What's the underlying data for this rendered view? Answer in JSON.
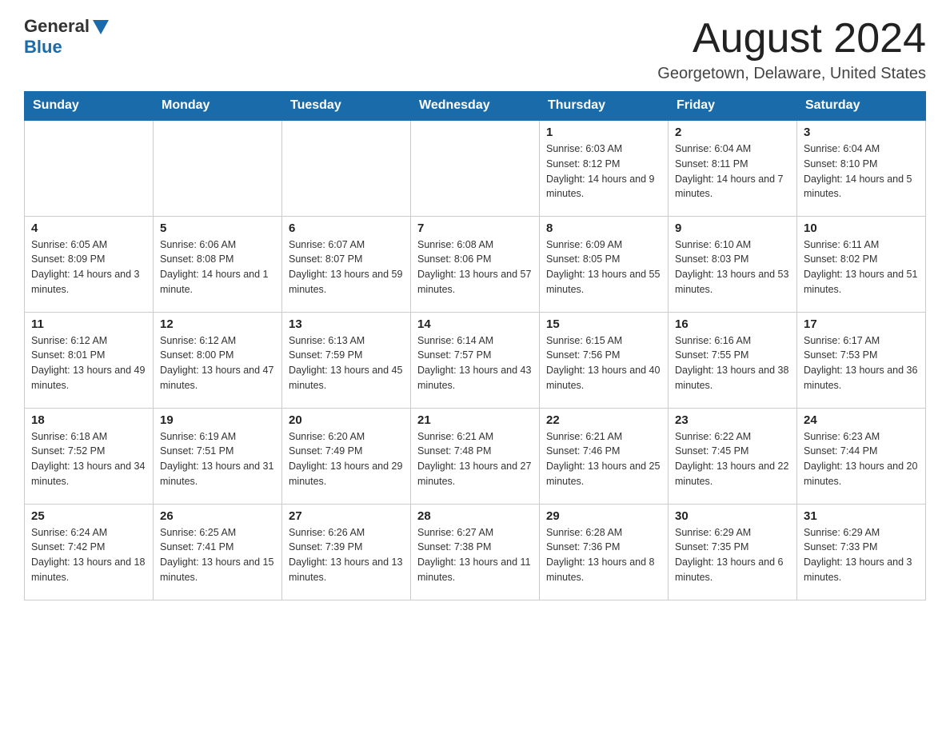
{
  "header": {
    "logo_general": "General",
    "logo_blue": "Blue",
    "month_title": "August 2024",
    "location": "Georgetown, Delaware, United States"
  },
  "weekdays": [
    "Sunday",
    "Monday",
    "Tuesday",
    "Wednesday",
    "Thursday",
    "Friday",
    "Saturday"
  ],
  "weeks": [
    [
      {
        "day": "",
        "info": ""
      },
      {
        "day": "",
        "info": ""
      },
      {
        "day": "",
        "info": ""
      },
      {
        "day": "",
        "info": ""
      },
      {
        "day": "1",
        "info": "Sunrise: 6:03 AM\nSunset: 8:12 PM\nDaylight: 14 hours and 9 minutes."
      },
      {
        "day": "2",
        "info": "Sunrise: 6:04 AM\nSunset: 8:11 PM\nDaylight: 14 hours and 7 minutes."
      },
      {
        "day": "3",
        "info": "Sunrise: 6:04 AM\nSunset: 8:10 PM\nDaylight: 14 hours and 5 minutes."
      }
    ],
    [
      {
        "day": "4",
        "info": "Sunrise: 6:05 AM\nSunset: 8:09 PM\nDaylight: 14 hours and 3 minutes."
      },
      {
        "day": "5",
        "info": "Sunrise: 6:06 AM\nSunset: 8:08 PM\nDaylight: 14 hours and 1 minute."
      },
      {
        "day": "6",
        "info": "Sunrise: 6:07 AM\nSunset: 8:07 PM\nDaylight: 13 hours and 59 minutes."
      },
      {
        "day": "7",
        "info": "Sunrise: 6:08 AM\nSunset: 8:06 PM\nDaylight: 13 hours and 57 minutes."
      },
      {
        "day": "8",
        "info": "Sunrise: 6:09 AM\nSunset: 8:05 PM\nDaylight: 13 hours and 55 minutes."
      },
      {
        "day": "9",
        "info": "Sunrise: 6:10 AM\nSunset: 8:03 PM\nDaylight: 13 hours and 53 minutes."
      },
      {
        "day": "10",
        "info": "Sunrise: 6:11 AM\nSunset: 8:02 PM\nDaylight: 13 hours and 51 minutes."
      }
    ],
    [
      {
        "day": "11",
        "info": "Sunrise: 6:12 AM\nSunset: 8:01 PM\nDaylight: 13 hours and 49 minutes."
      },
      {
        "day": "12",
        "info": "Sunrise: 6:12 AM\nSunset: 8:00 PM\nDaylight: 13 hours and 47 minutes."
      },
      {
        "day": "13",
        "info": "Sunrise: 6:13 AM\nSunset: 7:59 PM\nDaylight: 13 hours and 45 minutes."
      },
      {
        "day": "14",
        "info": "Sunrise: 6:14 AM\nSunset: 7:57 PM\nDaylight: 13 hours and 43 minutes."
      },
      {
        "day": "15",
        "info": "Sunrise: 6:15 AM\nSunset: 7:56 PM\nDaylight: 13 hours and 40 minutes."
      },
      {
        "day": "16",
        "info": "Sunrise: 6:16 AM\nSunset: 7:55 PM\nDaylight: 13 hours and 38 minutes."
      },
      {
        "day": "17",
        "info": "Sunrise: 6:17 AM\nSunset: 7:53 PM\nDaylight: 13 hours and 36 minutes."
      }
    ],
    [
      {
        "day": "18",
        "info": "Sunrise: 6:18 AM\nSunset: 7:52 PM\nDaylight: 13 hours and 34 minutes."
      },
      {
        "day": "19",
        "info": "Sunrise: 6:19 AM\nSunset: 7:51 PM\nDaylight: 13 hours and 31 minutes."
      },
      {
        "day": "20",
        "info": "Sunrise: 6:20 AM\nSunset: 7:49 PM\nDaylight: 13 hours and 29 minutes."
      },
      {
        "day": "21",
        "info": "Sunrise: 6:21 AM\nSunset: 7:48 PM\nDaylight: 13 hours and 27 minutes."
      },
      {
        "day": "22",
        "info": "Sunrise: 6:21 AM\nSunset: 7:46 PM\nDaylight: 13 hours and 25 minutes."
      },
      {
        "day": "23",
        "info": "Sunrise: 6:22 AM\nSunset: 7:45 PM\nDaylight: 13 hours and 22 minutes."
      },
      {
        "day": "24",
        "info": "Sunrise: 6:23 AM\nSunset: 7:44 PM\nDaylight: 13 hours and 20 minutes."
      }
    ],
    [
      {
        "day": "25",
        "info": "Sunrise: 6:24 AM\nSunset: 7:42 PM\nDaylight: 13 hours and 18 minutes."
      },
      {
        "day": "26",
        "info": "Sunrise: 6:25 AM\nSunset: 7:41 PM\nDaylight: 13 hours and 15 minutes."
      },
      {
        "day": "27",
        "info": "Sunrise: 6:26 AM\nSunset: 7:39 PM\nDaylight: 13 hours and 13 minutes."
      },
      {
        "day": "28",
        "info": "Sunrise: 6:27 AM\nSunset: 7:38 PM\nDaylight: 13 hours and 11 minutes."
      },
      {
        "day": "29",
        "info": "Sunrise: 6:28 AM\nSunset: 7:36 PM\nDaylight: 13 hours and 8 minutes."
      },
      {
        "day": "30",
        "info": "Sunrise: 6:29 AM\nSunset: 7:35 PM\nDaylight: 13 hours and 6 minutes."
      },
      {
        "day": "31",
        "info": "Sunrise: 6:29 AM\nSunset: 7:33 PM\nDaylight: 13 hours and 3 minutes."
      }
    ]
  ]
}
